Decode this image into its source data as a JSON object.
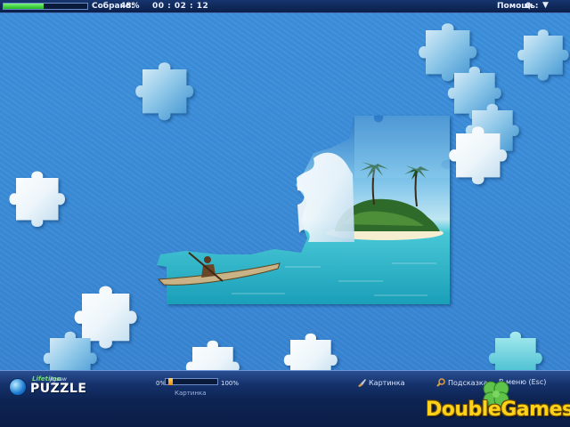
{
  "top_bar": {
    "progress": 0.48,
    "collected_label": "Собрано:",
    "collected_value": "48%",
    "timer": "00 : 02 : 12",
    "help_label": "Помощь:",
    "help_value": "0",
    "menu_arrow": "▼"
  },
  "bottom_bar": {
    "logo_small": "Lifetime",
    "logo_jigsaw": "jigsaw",
    "logo_main": "PUZZLE",
    "zoom_min": "0%",
    "zoom_max": "100%",
    "zoom_level": 0.05,
    "zoom_caption": "Картинка",
    "picture_button": "Картинка",
    "hint_button": "Подсказка",
    "menu_button": "В меню (Esc)"
  },
  "watermark": {
    "text": "DoubleGames"
  },
  "colors": {
    "board_blue": "#3a8ad8",
    "bar_navy": "#0d2454",
    "progress_green": "#1fb81f",
    "watermark_yellow": "#ffd21a"
  },
  "icons": {
    "picture": "brush-icon",
    "hint": "magnifier-icon",
    "logo": "globe-icon",
    "watermark": "clover-icon"
  }
}
